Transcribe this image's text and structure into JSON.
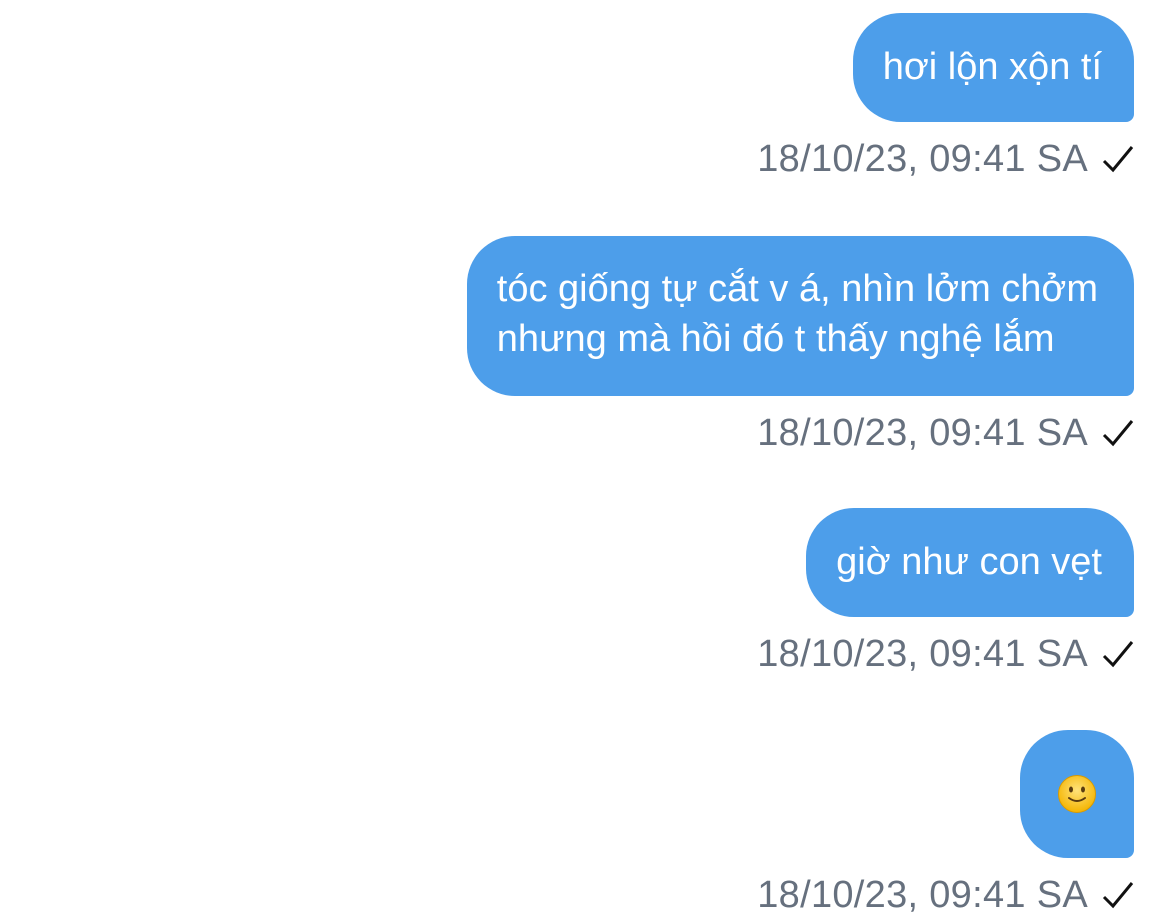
{
  "messages": [
    {
      "text": "hơi lộn xộn tí",
      "timestamp": "18/10/23, 09:41 SA",
      "status_icon": "check-icon"
    },
    {
      "text_lines": [
        "tóc giống tự cắt v á, nhìn lởm chởm",
        "nhưng mà hồi đó t thấy nghệ lắm"
      ],
      "timestamp": "18/10/23, 09:41 SA",
      "status_icon": "check-icon"
    },
    {
      "text": "giờ như con vẹt",
      "timestamp": "18/10/23, 09:41 SA",
      "status_icon": "check-icon"
    },
    {
      "emoji": "slightly-smiling-face-emoji",
      "timestamp": "18/10/23, 09:41 SA",
      "status_icon": "check-icon"
    }
  ],
  "colors": {
    "bubble": "#4d9eea",
    "bubble_text": "#ffffff",
    "timestamp": "#66707e",
    "check": "#111111",
    "background": "#ffffff"
  }
}
